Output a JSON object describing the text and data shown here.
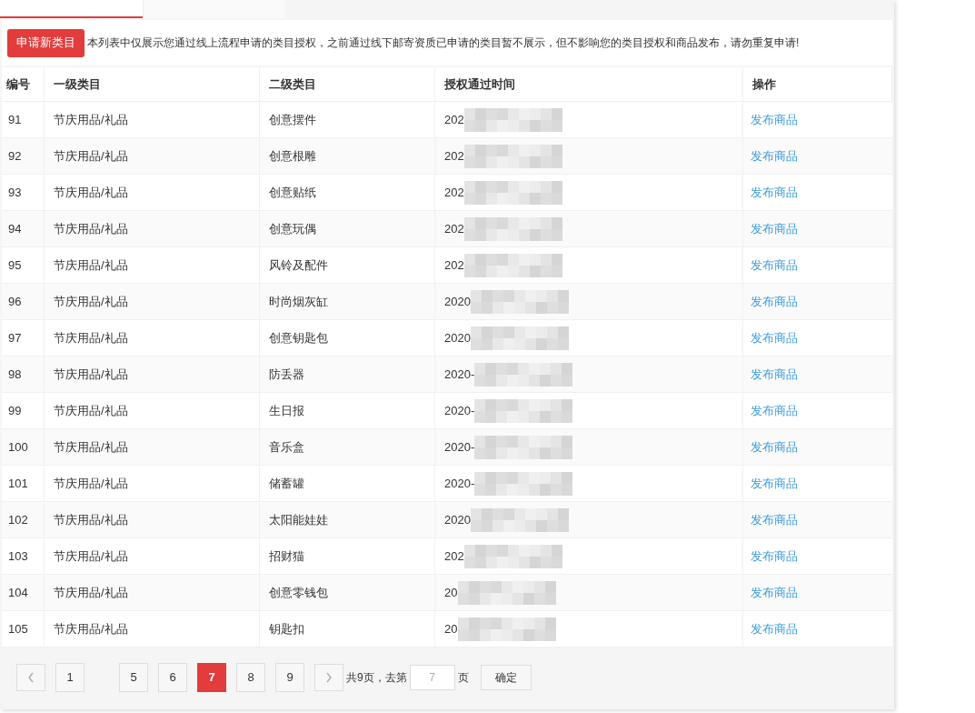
{
  "tabs": [
    {
      "selected": true
    },
    {
      "selected": false
    }
  ],
  "apply_button": "申请新类目",
  "notice": "本列表中仅展示您通过线上流程申请的类目授权，之前通过线下邮寄资质已申请的类目暂不展示，但不影响您的类目授权和商品发布，请勿重复申请!",
  "table": {
    "columns": [
      "编号",
      "一级类目",
      "二级类目",
      "授权通过时间",
      "操作"
    ],
    "rows": [
      {
        "id": "91",
        "level1": "节庆用品/礼品",
        "level2": "创意摆件",
        "time": "202",
        "action": "发布商品"
      },
      {
        "id": "92",
        "level1": "节庆用品/礼品",
        "level2": "创意根雕",
        "time": "202",
        "action": "发布商品"
      },
      {
        "id": "93",
        "level1": "节庆用品/礼品",
        "level2": "创意贴纸",
        "time": "202",
        "action": "发布商品"
      },
      {
        "id": "94",
        "level1": "节庆用品/礼品",
        "level2": "创意玩偶",
        "time": "202",
        "action": "发布商品"
      },
      {
        "id": "95",
        "level1": "节庆用品/礼品",
        "level2": "风铃及配件",
        "time": "202",
        "action": "发布商品"
      },
      {
        "id": "96",
        "level1": "节庆用品/礼品",
        "level2": "时尚烟灰缸",
        "time": "2020",
        "action": "发布商品"
      },
      {
        "id": "97",
        "level1": "节庆用品/礼品",
        "level2": "创意钥匙包",
        "time": "2020",
        "action": "发布商品"
      },
      {
        "id": "98",
        "level1": "节庆用品/礼品",
        "level2": "防丢器",
        "time": "2020-",
        "action": "发布商品"
      },
      {
        "id": "99",
        "level1": "节庆用品/礼品",
        "level2": "生日报",
        "time": "2020-",
        "action": "发布商品"
      },
      {
        "id": "100",
        "level1": "节庆用品/礼品",
        "level2": "音乐盒",
        "time": "2020-",
        "action": "发布商品"
      },
      {
        "id": "101",
        "level1": "节庆用品/礼品",
        "level2": "储蓄罐",
        "time": "2020-",
        "action": "发布商品"
      },
      {
        "id": "102",
        "level1": "节庆用品/礼品",
        "level2": "太阳能娃娃",
        "time": "2020",
        "action": "发布商品"
      },
      {
        "id": "103",
        "level1": "节庆用品/礼品",
        "level2": "招财猫",
        "time": "202",
        "action": "发布商品"
      },
      {
        "id": "104",
        "level1": "节庆用品/礼品",
        "level2": "创意零钱包",
        "time": "20",
        "action": "发布商品"
      },
      {
        "id": "105",
        "level1": "节庆用品/礼品",
        "level2": "钥匙扣",
        "time": "20",
        "action": "发布商品"
      }
    ]
  },
  "pagination": {
    "pages": [
      {
        "label": "1",
        "selected": false
      },
      {
        "label": "5",
        "selected": false
      },
      {
        "label": "6",
        "selected": false
      },
      {
        "label": "7",
        "selected": true
      },
      {
        "label": "8",
        "selected": false
      },
      {
        "label": "9",
        "selected": false
      }
    ],
    "total": "共9页，去第",
    "goto_value": "7",
    "unit": "页",
    "confirm": "确定"
  }
}
